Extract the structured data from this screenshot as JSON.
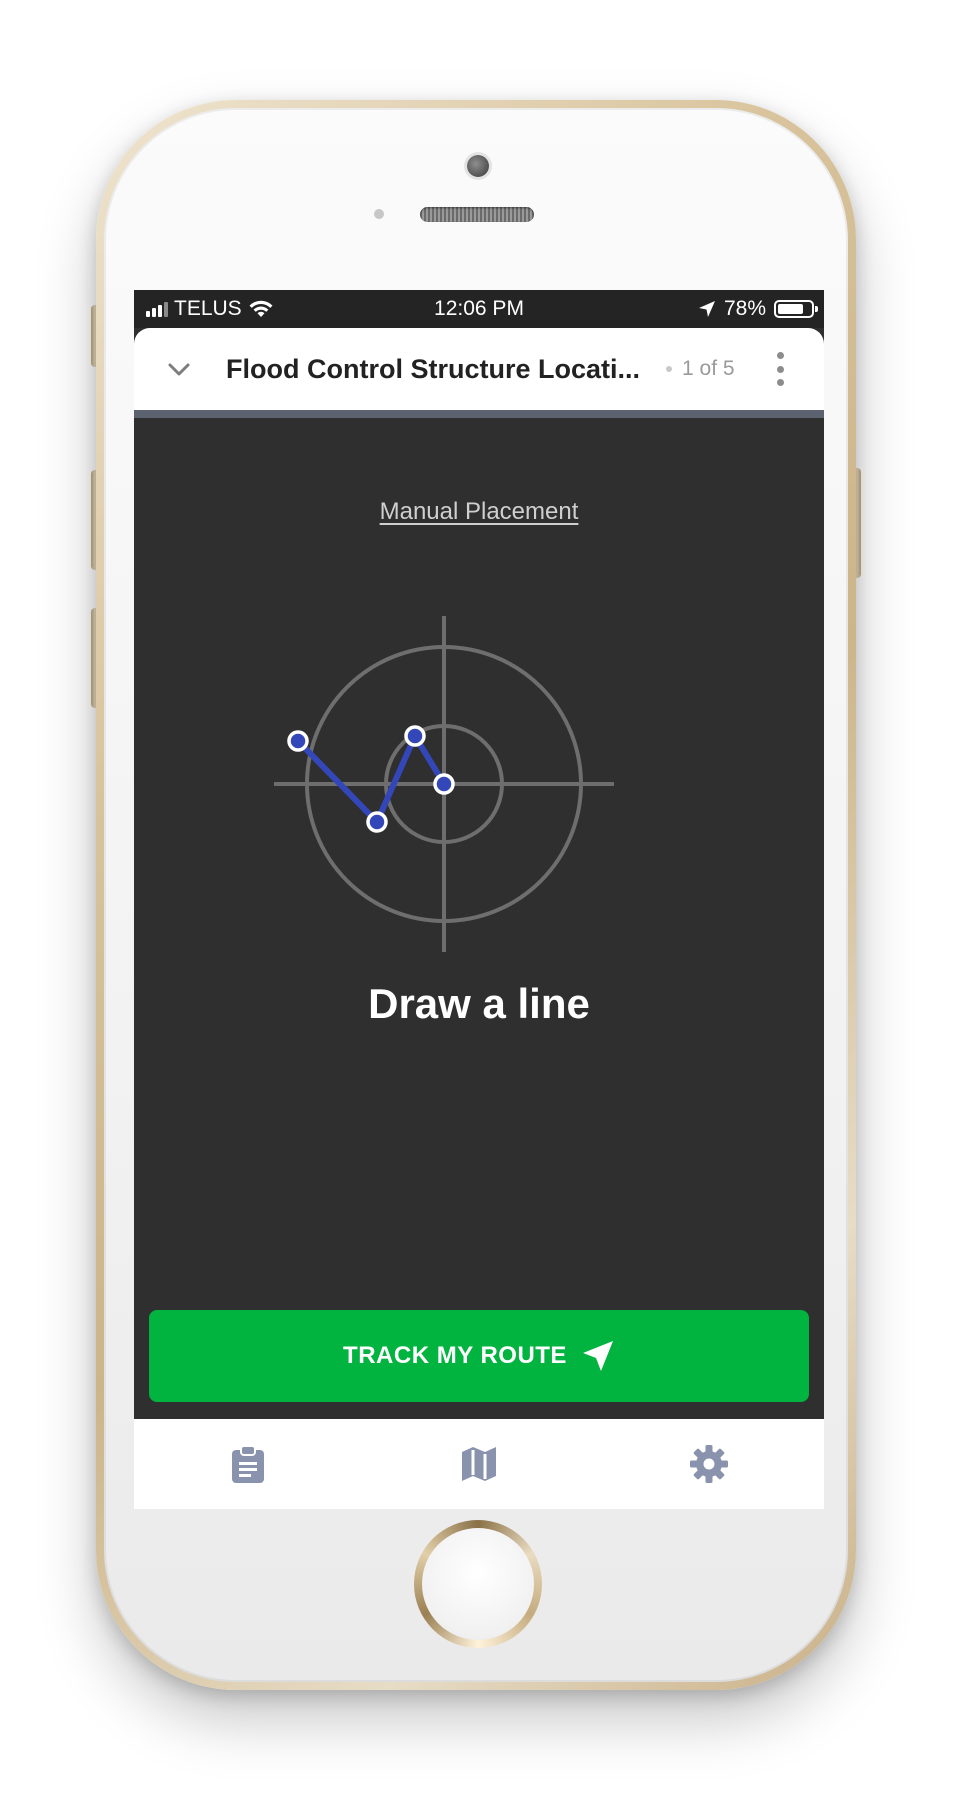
{
  "status_bar": {
    "carrier": "TELUS",
    "time": "12:06 PM",
    "battery_percent": "78%",
    "battery_level": 0.78
  },
  "header": {
    "title": "Flood Control Structure Locati...",
    "page_counter": "1 of 5"
  },
  "content": {
    "manual_placement_link": "Manual Placement",
    "prompt": "Draw a line"
  },
  "actions": {
    "track_route_label": "TRACK MY ROUTE"
  },
  "bottom_nav": {
    "items": [
      {
        "icon": "clipboard-icon"
      },
      {
        "icon": "map-icon"
      },
      {
        "icon": "gear-icon"
      }
    ]
  },
  "colors": {
    "screen_bg": "#2f2f2f",
    "accent_green": "#00b43f",
    "line_blue": "#3347b8",
    "nav_icon": "#8a93ad",
    "header_divider": "#5d6270"
  }
}
